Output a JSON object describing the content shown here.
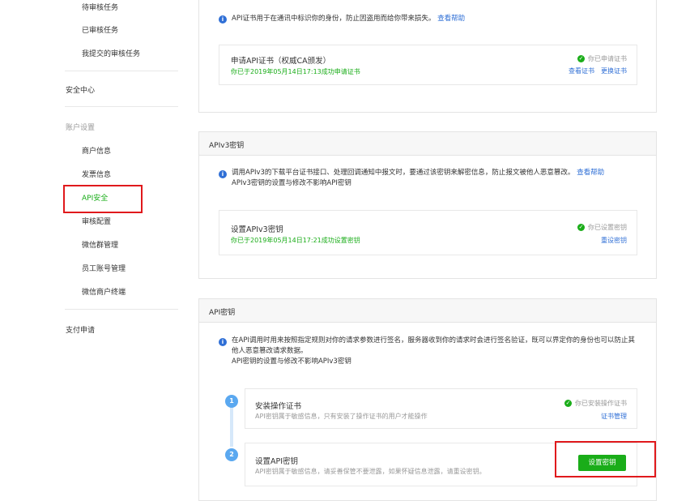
{
  "sidebar": {
    "items_top": [
      "待审核任务",
      "已审核任务",
      "我提交的审核任务"
    ],
    "security_center": "安全中心",
    "account_settings": "账户设置",
    "account_items": [
      "商户信息",
      "发票信息",
      "API安全",
      "审核配置",
      "微信群管理",
      "员工账号管理",
      "微信商户终端"
    ],
    "pay_apply": "支付申请"
  },
  "cert_section": {
    "info": "API证书用于在通讯中标识你的身份，防止因盗用而给你带来损失。",
    "help_link": "查看帮助",
    "title": "申请API证书（权威CA颁发）",
    "subtitle": "你已于2019年05月14日17:13成功申请证书",
    "status": "你已申请证书",
    "action_view": "查看证书",
    "action_replace": "更换证书"
  },
  "apiv3_section": {
    "header": "APIv3密钥",
    "info_line1": "调用APIv3的下载平台证书接口、处理回调通知中报文时，要通过该密钥来解密信息，防止报文被他人恶意篡改。",
    "help_link": "查看帮助",
    "info_line2": "APIv3密钥的设置与修改不影响API密钥",
    "title": "设置APIv3密钥",
    "subtitle": "你已于2019年05月14日17:21成功设置密钥",
    "status": "你已设置密钥",
    "action_reset": "重设密钥"
  },
  "apikey_section": {
    "header": "API密钥",
    "info_line1": "在API调用时用来按照指定规则对你的请求参数进行签名，服务器收到你的请求时会进行签名验证，既可以界定你的身份也可以防止其",
    "info_line2": "他人恶意篡改请求数据。",
    "info_line3": "API密钥的设置与修改不影响APIv3密钥",
    "steps": [
      {
        "number": "1",
        "title": "安装操作证书",
        "desc": "API密钥属于敏感信息，只有安装了操作证书的用户才能操作",
        "status": "你已安装操作证书",
        "action": "证书管理"
      },
      {
        "number": "2",
        "title": "设置API密钥",
        "desc": "API密钥属于敏感信息，请妥善保管不要泄露，如果怀疑信息泄露，请重设密钥。",
        "button": "设置密钥"
      }
    ]
  },
  "colors": {
    "accent_green": "#1aad19",
    "link_blue": "#2f6fd6",
    "highlight_red": "#e0191c"
  }
}
